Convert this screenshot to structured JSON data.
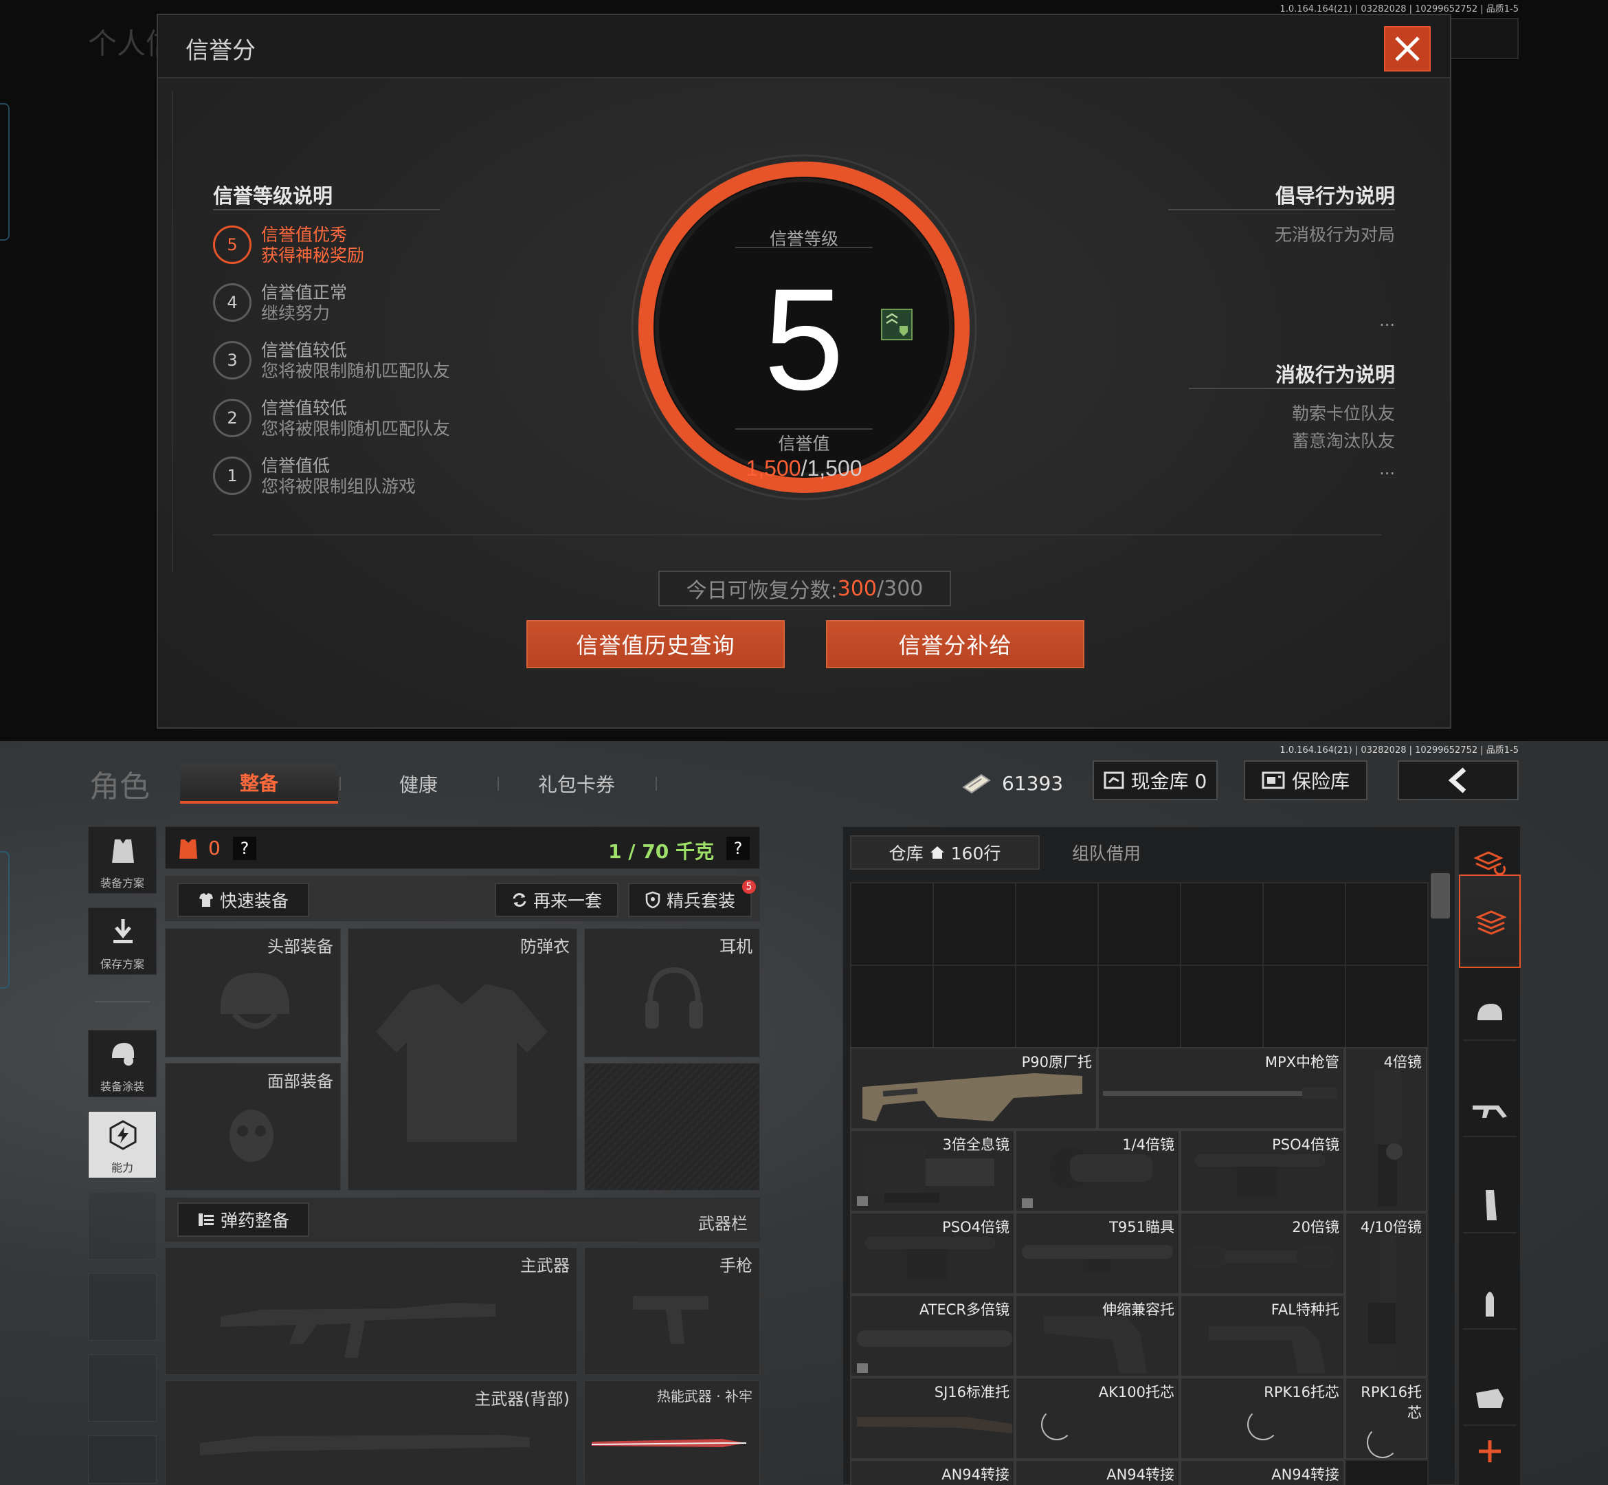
{
  "top": {
    "version": "1.0.164.164(21) | 03282028 | 10299652752 | 品质1-5",
    "background_title": "个人信",
    "modal": {
      "title": "信誉分",
      "close_icon": "close-icon",
      "levels_title": "信誉等级说明",
      "levels": [
        {
          "num": "5",
          "line1": "信誉值优秀",
          "line2": "获得神秘奖励",
          "active": true
        },
        {
          "num": "4",
          "line1": "信誉值正常",
          "line2": "继续努力",
          "active": false
        },
        {
          "num": "3",
          "line1": "信誉值较低",
          "line2": "您将被限制随机匹配队友",
          "active": false
        },
        {
          "num": "2",
          "line1": "信誉值较低",
          "line2": "您将被限制随机匹配队友",
          "active": false
        },
        {
          "num": "1",
          "line1": "信誉值低",
          "line2": "您将被限制组队游戏",
          "active": false
        }
      ],
      "center": {
        "level_label": "信誉等级",
        "level": "5",
        "value_label": "信誉值",
        "value_current": "1,500",
        "value_max": "/1,500"
      },
      "positive_title": "倡导行为说明",
      "positive_items": [
        "无消极行为对局"
      ],
      "negative_title": "消极行为说明",
      "negative_items": [
        "勒索卡位队友",
        "蓄意淘汰队友"
      ],
      "ellipsis": "...",
      "restore_label": "今日可恢复分数:",
      "restore_current": "300",
      "restore_max": "/300",
      "btn_history": "信誉值历史查询",
      "btn_supply": "信誉分补给",
      "accent": "#e8542a"
    }
  },
  "bottom": {
    "version": "1.0.164.164(21) | 03282028 | 10299652752 | 品质1-5",
    "role_title": "角色",
    "tabs": [
      {
        "label": "整备",
        "active": true
      },
      {
        "label": "健康",
        "active": false
      },
      {
        "label": "礼包卡券",
        "active": false
      }
    ],
    "currency": "61393",
    "cash_vault": "现金库 0",
    "safe_box": "保险库",
    "sidebar": [
      {
        "label": "装备方案",
        "icon": "vest-icon"
      },
      {
        "label": "保存方案",
        "icon": "download-icon"
      },
      {
        "label": "装备涂装",
        "icon": "helmet-paint-icon"
      },
      {
        "label": "能力",
        "icon": "ability-icon"
      }
    ],
    "loadout": {
      "armor_count": "0",
      "weight": "1 / 70 千克",
      "help": "?",
      "quick_equip": "快速装备",
      "again": "再来一套",
      "elite_set": "精兵套装",
      "elite_badge": "5",
      "slots": {
        "head": "头部装备",
        "vest": "防弹衣",
        "ear": "耳机",
        "face": "面部装备",
        "ammo_btn": "弹药整备",
        "weapon_bar": "武器栏",
        "primary": "主武器",
        "pistol": "手枪",
        "primary_back": "主武器(背部)",
        "melee": "热能武器 · 补牢"
      }
    },
    "inventory": {
      "tab_storage": "仓库",
      "storage_rows": "160行",
      "tab_team": "组队借用",
      "items": [
        "P90原厂托",
        "MPX中枪管",
        "4倍镜",
        "3倍全息镜",
        "1/4倍镜",
        "PSO4倍镜",
        "PSO4倍镜",
        "T951瞄具",
        "20倍镜",
        "4/10倍镜",
        "ATECR多倍镜",
        "伸缩兼容托",
        "FAL特种托",
        "SJ16标准托",
        "AK100托芯",
        "RPK16托芯",
        "RPK16托芯",
        "AN94转接",
        "AN94转接",
        "AN94转接"
      ]
    }
  }
}
